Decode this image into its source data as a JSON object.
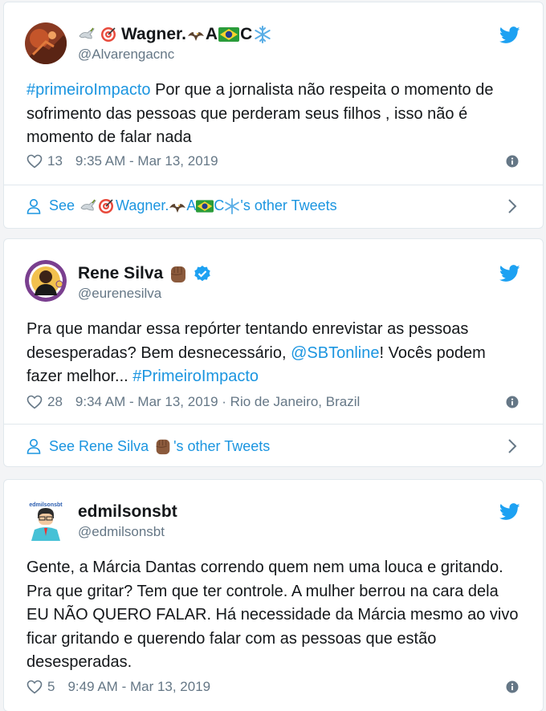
{
  "tweets": [
    {
      "display_name_main": "Wagner.",
      "display_name_a": "A",
      "display_name_c": "C",
      "handle": "@Alvarengacnc",
      "text_hashtag": "#primeiroImpacto",
      "text_body": " Por que a jornalista não respeita o momento de sofrimento das pessoas que perderam seus filhos , isso não é momento de falar nada",
      "likes": "13",
      "timestamp": "9:35 AM - Mar 13, 2019",
      "see_prefix": "See",
      "see_name_main": "Wagner.",
      "see_name_a": "A",
      "see_name_c": "C",
      "see_suffix": "'s other Tweets"
    },
    {
      "display_name": "Rene Silva",
      "handle": "@eurenesilva",
      "text_part1": "Pra que mandar essa repórter tentando enrevistar as pessoas desesperadas? Bem desnecessário, ",
      "mention": "@SBTonline",
      "text_part2": "! Vocês podem fazer melhor... ",
      "hashtag": "#PrimeiroImpacto",
      "likes": "28",
      "timestamp": "9:34 AM - Mar 13, 2019 · Rio de Janeiro, Brazil",
      "see_prefix": "See Rene Silva",
      "see_suffix": "'s other Tweets"
    },
    {
      "display_name": "edmilsonsbt",
      "handle": "@edmilsonsbt",
      "avatar_caption": "edmilsonsbt",
      "text": "Gente, a Márcia Dantas correndo quem nem uma louca e gritando. Pra que gritar? Tem que ter controle. A mulher berrou na cara dela EU NÃO QUERO FALAR. Há necessidade da Márcia mesmo ao vivo ficar gritando e querendo falar com as pessoas que estão desesperadas.",
      "likes": "5",
      "timestamp": "9:49 AM - Mar 13, 2019"
    }
  ],
  "icons": {
    "twitter": "twitter-bird-icon",
    "heart": "heart-icon",
    "info": "info-icon",
    "person": "person-icon",
    "chevron": "chevron-right-icon",
    "verified": "verified-badge-icon"
  },
  "colors": {
    "link": "#1b95e0",
    "muted": "#657786",
    "text": "#14171a",
    "border": "#e1e8ed"
  }
}
